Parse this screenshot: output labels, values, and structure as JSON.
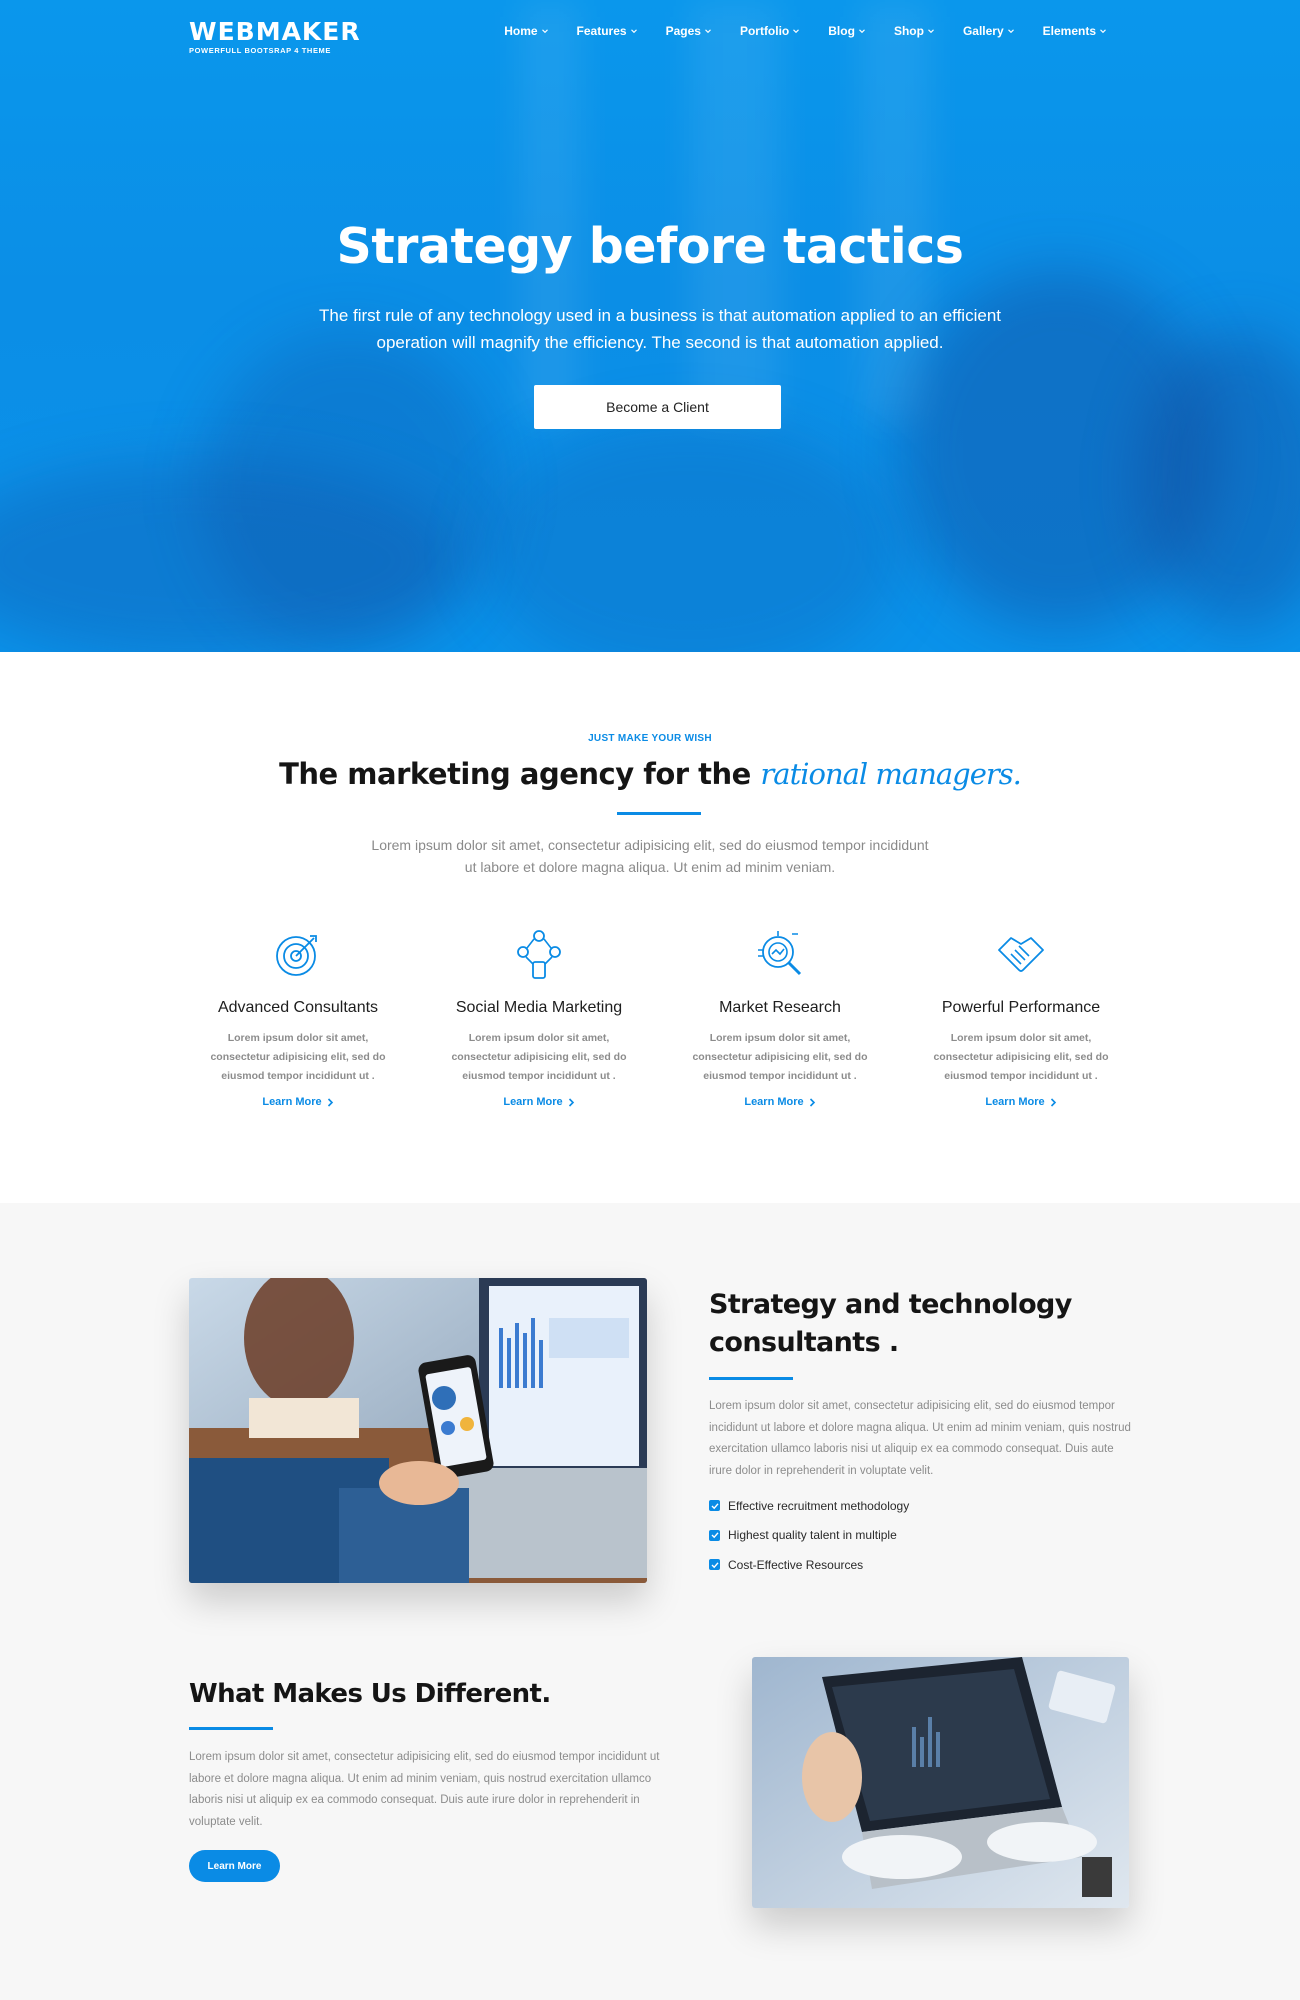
{
  "brand": {
    "name": "WEBMAKER",
    "tagline": "POWERFULL BOOTSRAP 4 THEME"
  },
  "nav": {
    "items": [
      {
        "label": "Home"
      },
      {
        "label": "Features"
      },
      {
        "label": "Pages"
      },
      {
        "label": "Portfolio"
      },
      {
        "label": "Blog"
      },
      {
        "label": "Shop"
      },
      {
        "label": "Gallery"
      },
      {
        "label": "Elements"
      }
    ]
  },
  "hero": {
    "title": "Strategy before tactics",
    "text_line1": "The first rule of any technology used in a business is that automation applied to an efficient",
    "text_line2": "operation will magnify the efficiency. The second is that automation applied.",
    "button": "Become a Client"
  },
  "services": {
    "eyebrow": "JUST MAKE YOUR WISH",
    "title_main": "The marketing agency for the ",
    "title_accent": "rational managers.",
    "lead_line1": "Lorem ipsum dolor sit amet, consectetur adipisicing elit, sed do eiusmod tempor incididunt",
    "lead_line2": "ut labore et dolore magna aliqua. Ut enim ad minim veniam.",
    "features": [
      {
        "title": "Advanced Consultants",
        "icon": "target-icon",
        "desc": "Lorem ipsum dolor sit amet, consectetur adipisicing elit, sed do eiusmod tempor incididunt ut .",
        "link": "Learn More"
      },
      {
        "title": "Social Media Marketing",
        "icon": "social-network-icon",
        "desc": "Lorem ipsum dolor sit amet, consectetur adipisicing elit, sed do eiusmod tempor incididunt ut .",
        "link": "Learn More"
      },
      {
        "title": "Market Research",
        "icon": "research-magnifier-icon",
        "desc": "Lorem ipsum dolor sit amet, consectetur adipisicing elit, sed do eiusmod tempor incididunt ut .",
        "link": "Learn More"
      },
      {
        "title": "Powerful Performance",
        "icon": "handshake-icon",
        "desc": "Lorem ipsum dolor sit amet, consectetur adipisicing elit, sed do eiusmod tempor incididunt ut .",
        "link": "Learn More"
      }
    ]
  },
  "about": {
    "title_line1": "Strategy and technology",
    "title_line2": "consultants .",
    "text": "Lorem ipsum dolor sit amet, consectetur adipisicing elit, sed do eiusmod tempor incididunt ut labore et dolore magna aliqua. Ut enim ad minim veniam, quis nostrud exercitation ullamco laboris nisi ut aliquip ex ea commodo consequat. Duis aute irure dolor in reprehenderit in voluptate velit.",
    "checklist": [
      "Effective recruitment methodology",
      "Highest quality talent in multiple",
      "Cost-Effective Resources"
    ]
  },
  "different": {
    "title": "What Makes Us Different.",
    "text": "Lorem ipsum dolor sit amet, consectetur adipisicing elit, sed do eiusmod tempor incididunt ut labore et dolore magna aliqua. Ut enim ad minim veniam, quis nostrud exercitation ullamco laboris nisi ut aliquip ex ea commodo consequat. Duis aute irure dolor in reprehenderit in voluptate velit.",
    "button": "Learn More"
  },
  "colors": {
    "accent": "#0a8be5",
    "hero_bg": "#0b8ee6",
    "section_bg": "#f7f7f7"
  }
}
